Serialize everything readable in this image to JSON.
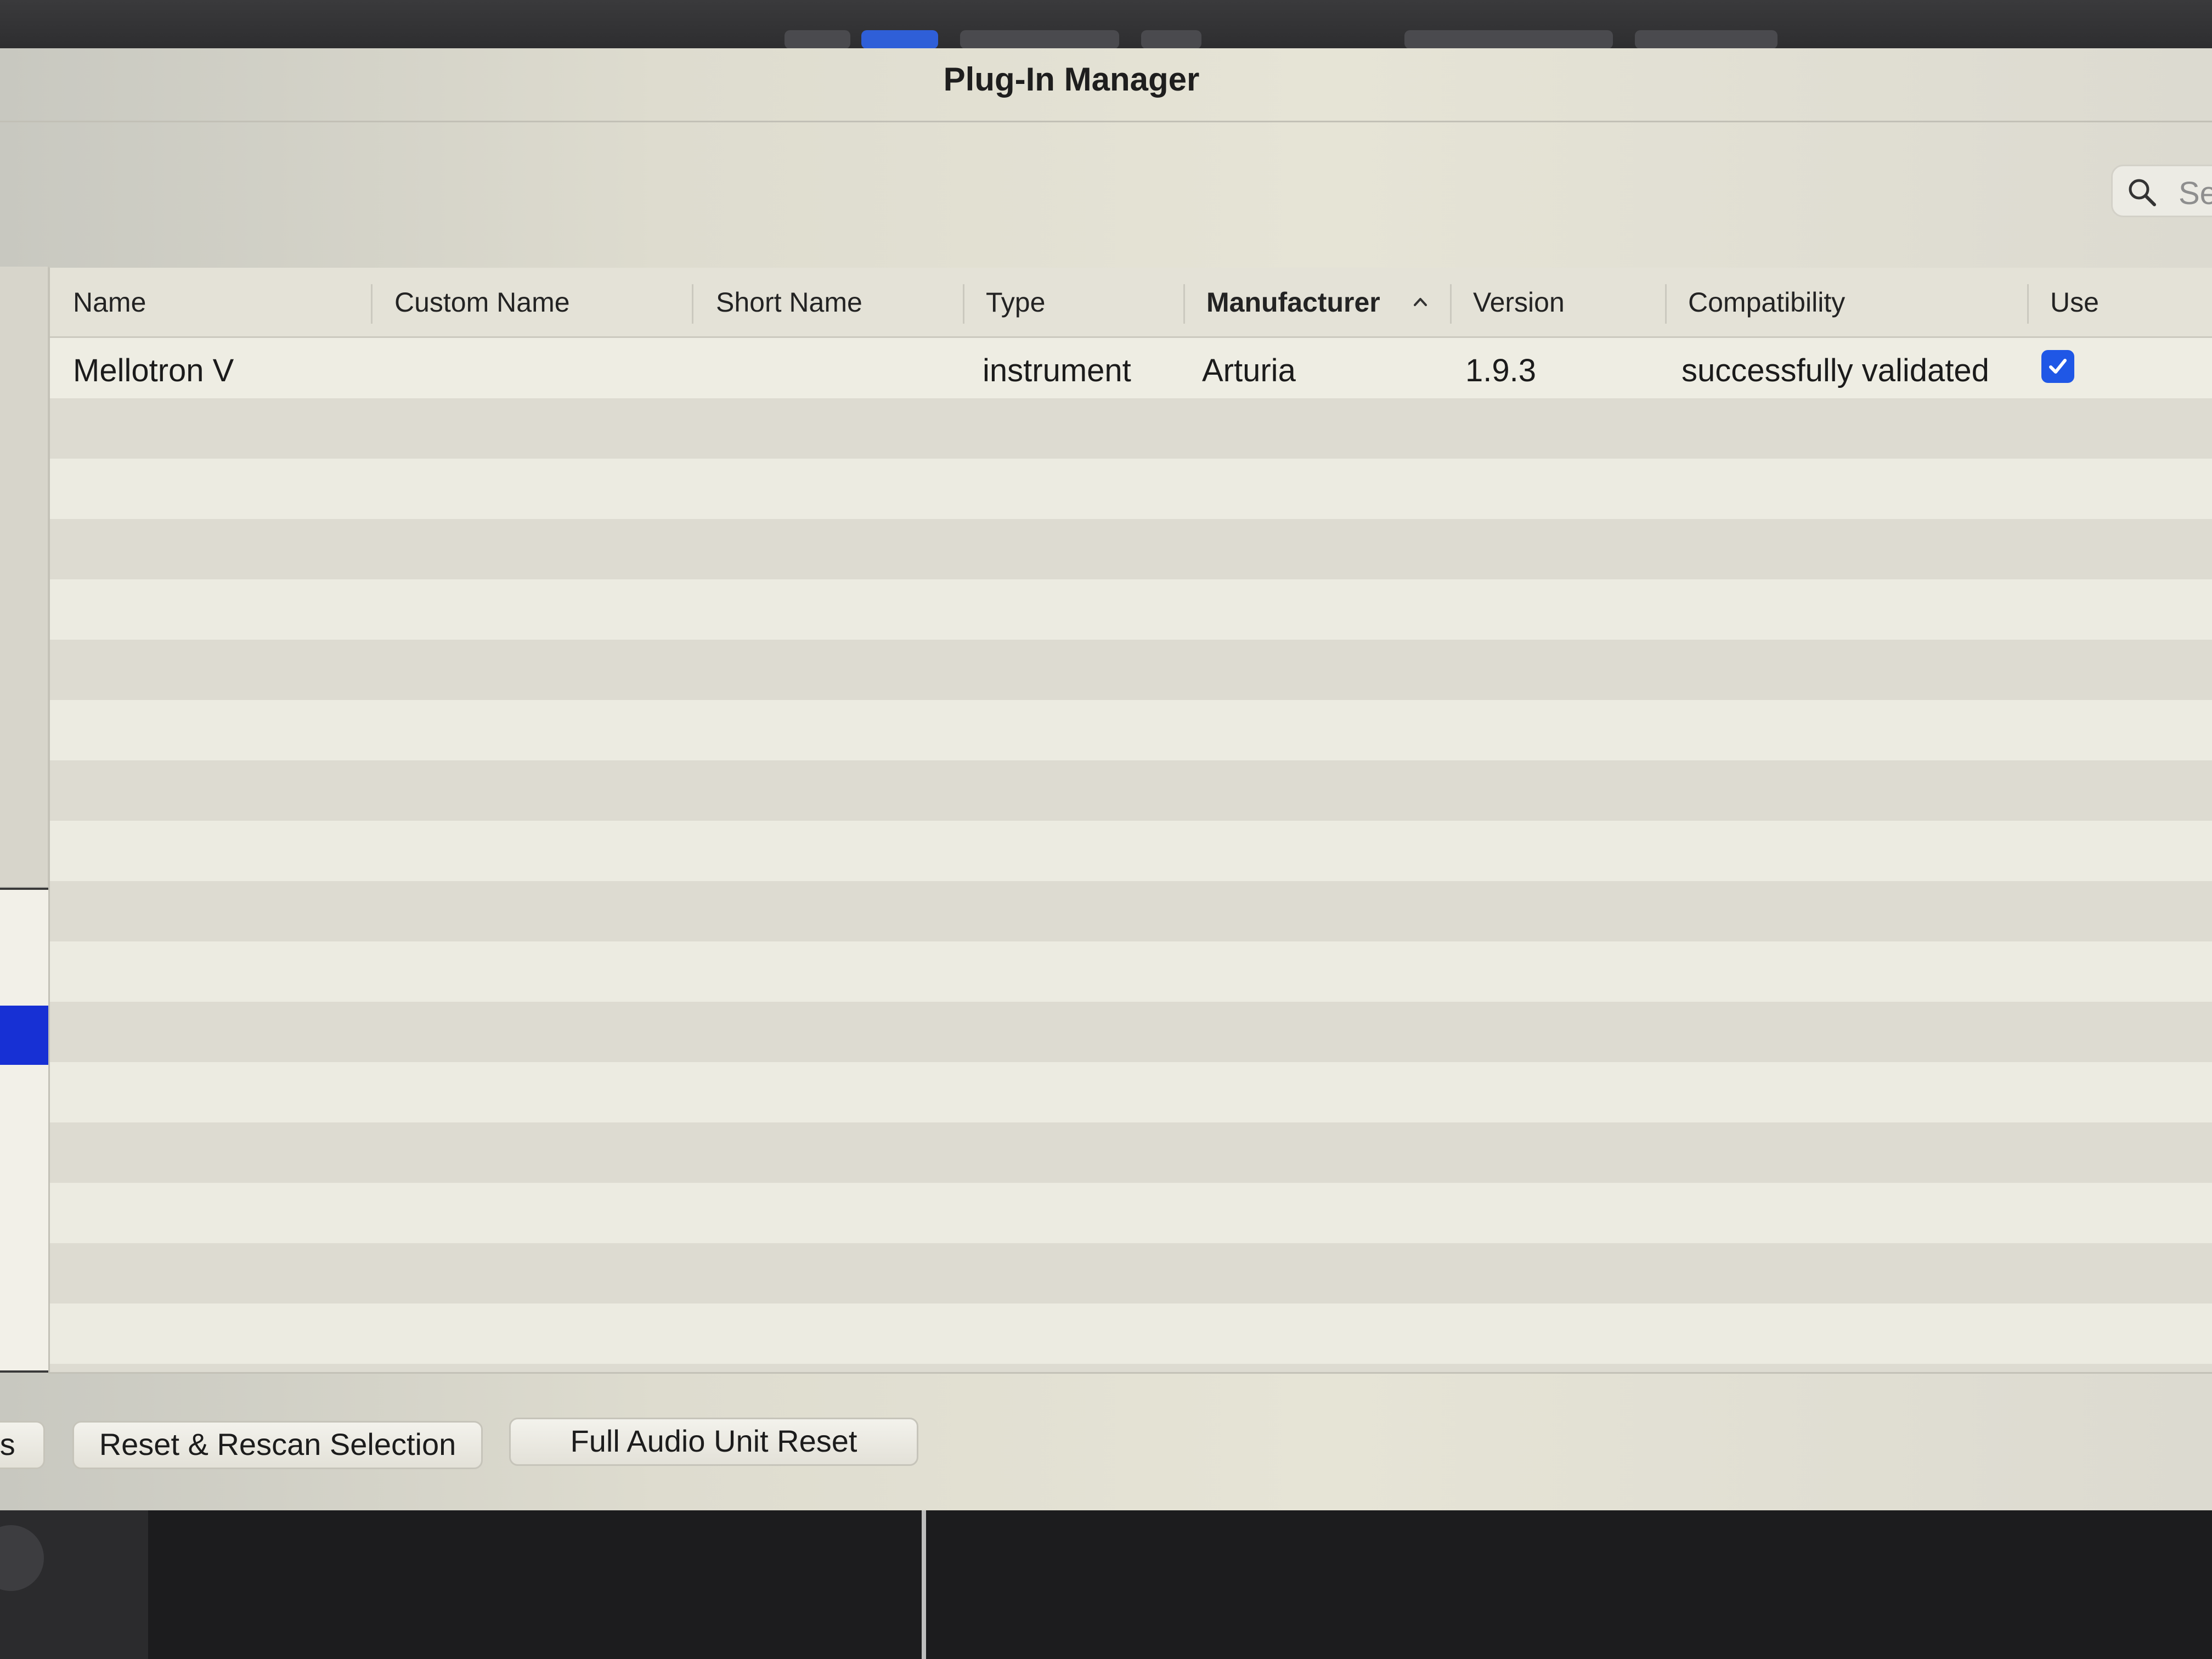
{
  "window": {
    "title": "Plug-In Manager"
  },
  "search": {
    "placeholder": "Se"
  },
  "table": {
    "columns": [
      {
        "label": "Name"
      },
      {
        "label": "Custom Name"
      },
      {
        "label": "Short Name"
      },
      {
        "label": "Type"
      },
      {
        "label": "Manufacturer",
        "sorted": "ascending"
      },
      {
        "label": "Version"
      },
      {
        "label": "Compatibility"
      },
      {
        "label": "Use"
      }
    ],
    "rows": [
      {
        "name": "Mellotron V",
        "custom_name": "",
        "short_name": "",
        "type": "instrument",
        "manufacturer": "Arturia",
        "version": "1.9.3",
        "compatibility": "successfully validated",
        "use": true
      }
    ]
  },
  "buttons": {
    "partial_left": "ts",
    "reset_rescan": "Reset & Rescan Selection",
    "full_reset": "Full Audio Unit Reset"
  },
  "colors": {
    "accent": "#1f57e6",
    "selection": "#1730d4"
  }
}
